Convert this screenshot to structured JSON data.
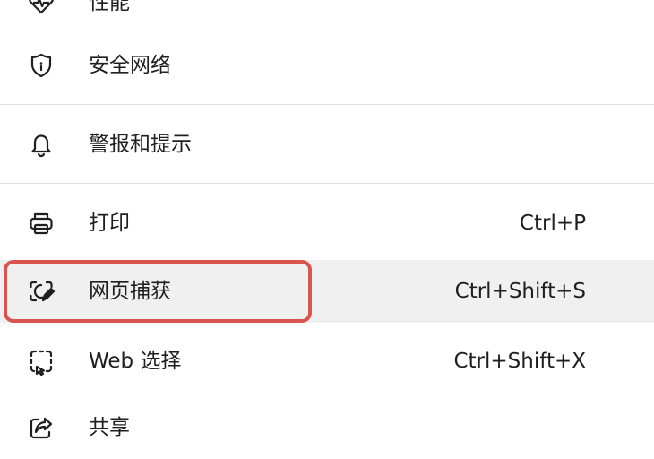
{
  "menu": {
    "items": [
      {
        "label": "性能",
        "shortcut": "",
        "icon": "heart-pulse-icon"
      },
      {
        "label": "安全网络",
        "shortcut": "",
        "icon": "shield-icon"
      },
      {
        "label": "警报和提示",
        "shortcut": "",
        "icon": "bell-icon"
      },
      {
        "label": "打印",
        "shortcut": "Ctrl+P",
        "icon": "printer-icon"
      },
      {
        "label": "网页捕获",
        "shortcut": "Ctrl+Shift+S",
        "icon": "web-capture-icon",
        "hovered": true,
        "highlighted": true
      },
      {
        "label": "Web 选择",
        "shortcut": "Ctrl+Shift+X",
        "icon": "web-select-icon"
      },
      {
        "label": "共享",
        "shortcut": "",
        "icon": "share-icon"
      }
    ]
  },
  "colors": {
    "highlight_border": "#d9534f",
    "hover_background": "#f0f0f0",
    "divider": "#dedede",
    "text": "#1f1f1f"
  }
}
